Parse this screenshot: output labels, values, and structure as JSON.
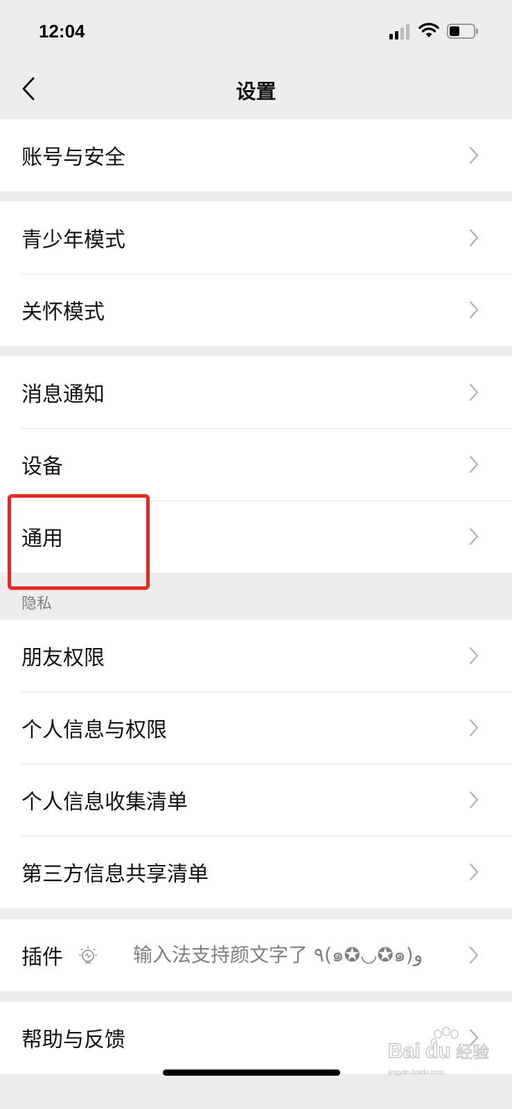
{
  "status_bar": {
    "time": "12:04"
  },
  "header": {
    "title": "设置"
  },
  "groups": [
    {
      "items": [
        {
          "label": "账号与安全"
        }
      ]
    },
    {
      "items": [
        {
          "label": "青少年模式"
        },
        {
          "label": "关怀模式"
        }
      ]
    },
    {
      "items": [
        {
          "label": "消息通知"
        },
        {
          "label": "设备"
        },
        {
          "label": "通用"
        }
      ]
    },
    {
      "title": "隐私",
      "items": [
        {
          "label": "朋友权限"
        },
        {
          "label": "个人信息与权限"
        },
        {
          "label": "个人信息收集清单"
        },
        {
          "label": "第三方信息共享清单"
        }
      ]
    },
    {
      "items": [
        {
          "label": "插件",
          "tip": "输入法支持颜文字了 ٩(๑✪◡✪๑)و"
        }
      ]
    },
    {
      "items": [
        {
          "label": "帮助与反馈"
        }
      ]
    }
  ],
  "watermark": {
    "brand": "Bai",
    "brand2": "du",
    "cn": "经验",
    "url": "jingyan.baidu.com"
  },
  "colors": {
    "highlight": "#f2241d",
    "background": "#ededed"
  }
}
